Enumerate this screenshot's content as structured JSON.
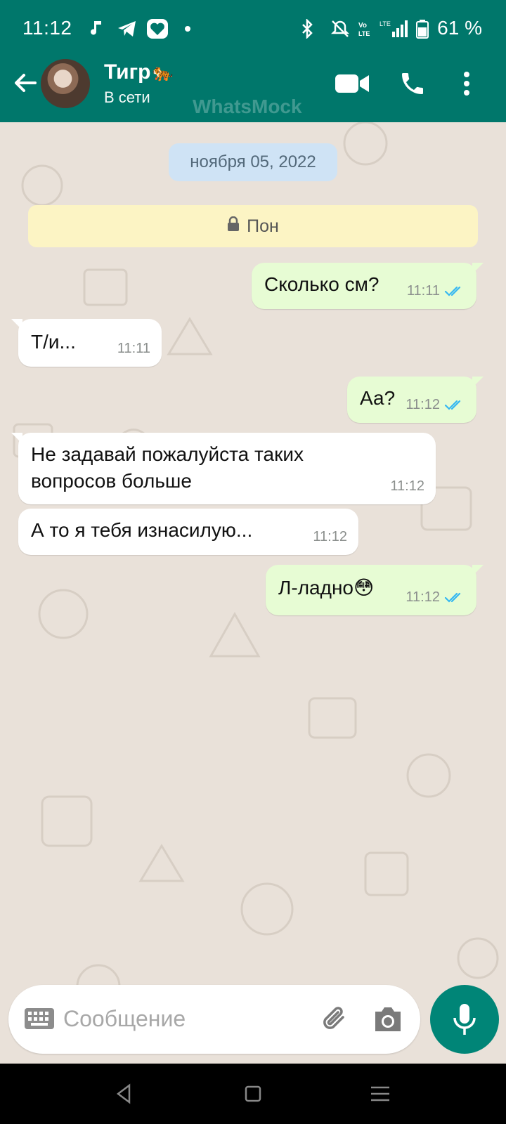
{
  "status_bar": {
    "time": "11:12",
    "battery_pct": "61 %",
    "icons": [
      "music-note-icon",
      "telegram-icon",
      "app-heart-icon",
      "dot-icon",
      "bluetooth-icon",
      "mute-icon",
      "volte-icon",
      "lte-signal-icon",
      "battery-icon"
    ]
  },
  "header": {
    "contact_name": "Тигр",
    "contact_emoji": "🐅",
    "presence": "В сети",
    "watermark": "WhatsMock",
    "actions": [
      "video-call-icon",
      "phone-icon",
      "more-vert-icon"
    ]
  },
  "chat": {
    "date_pill": "ноября 05, 2022",
    "system_message": "Пон",
    "messages": [
      {
        "direction": "out",
        "text": "Сколько см?",
        "time": "11:11",
        "read": true
      },
      {
        "direction": "in",
        "text": "Т/и...",
        "time": "11:11"
      },
      {
        "direction": "out",
        "text": "Аа?",
        "time": "11:12",
        "read": true
      },
      {
        "direction": "in",
        "text": "Не задавай пожалуйста таких вопросов больше",
        "time": "11:12"
      },
      {
        "direction": "in",
        "text": "А то я тебя изнасилую...",
        "time": "11:12"
      },
      {
        "direction": "out",
        "text": "Л-ладно😳",
        "time": "11:12",
        "read": true
      }
    ]
  },
  "composer": {
    "placeholder": "Сообщение"
  },
  "colors": {
    "header": "#00776b",
    "accent": "#008577",
    "outgoing_bubble": "#e7fcd4",
    "read_tick": "#34b7f1"
  }
}
